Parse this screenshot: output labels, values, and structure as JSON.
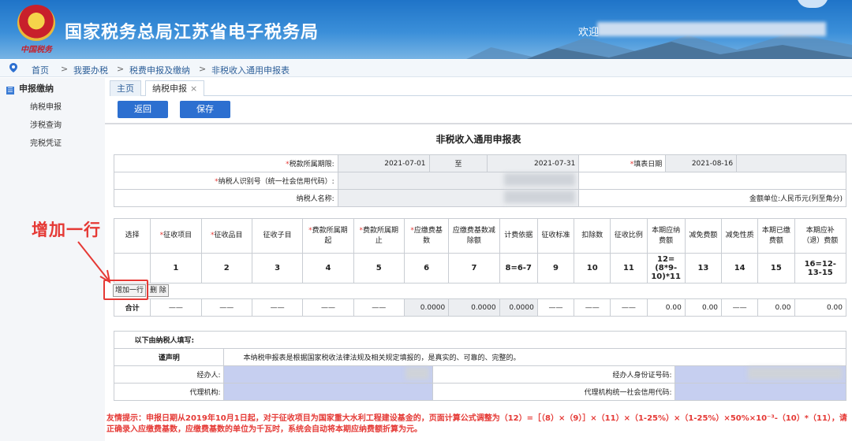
{
  "header": {
    "site_title": "国家税务总局江苏省电子税务局",
    "logo_text": "中国税务",
    "welcome": "欢迎"
  },
  "breadcrumb": [
    "首页",
    "我要办税",
    "税费申报及缴纳",
    "非税收入通用申报表"
  ],
  "sidebar": {
    "heading": "申报缴纳",
    "items": [
      "纳税申报",
      "涉税查询",
      "完税凭证"
    ]
  },
  "tabs": [
    {
      "label": "主页"
    },
    {
      "label": "纳税申报",
      "close": "×"
    }
  ],
  "toolbar": {
    "back_label": "返回",
    "save_label": "保存"
  },
  "form": {
    "title": "非税收入通用申报表",
    "period_label": "税款所属期限:",
    "period_start": "2021-07-01",
    "period_to": "至",
    "period_end": "2021-07-31",
    "fill_date_label": "填表日期",
    "fill_date": "2021-08-16",
    "taxpayer_id_label": "纳税人识别号（统一社会信用代码）:",
    "taxpayer_name_label": "纳税人名称:",
    "amount_unit": "金额单位:人民币元(列至角分)"
  },
  "table": {
    "headers": [
      "选择",
      "征收项目",
      "征收品目",
      "征收子目",
      "费款所属期起",
      "费款所属期止",
      "应缴费基数",
      "应缴费基数减除额",
      "计费依据",
      "征收标准",
      "扣除数",
      "征收比例",
      "本期应纳费额",
      "减免费额",
      "减免性质",
      "本期已缴费额",
      "本期应补（退）费额"
    ],
    "required_cols": [
      1,
      2,
      4,
      5,
      6
    ],
    "numbers": [
      "",
      "1",
      "2",
      "3",
      "4",
      "5",
      "6",
      "7",
      "8=6-7",
      "9",
      "10",
      "11",
      "12=(8*9-10)*11",
      "13",
      "14",
      "15",
      "16=12-13-15"
    ],
    "add_row_label": "增加一行",
    "delete_label": "删 除",
    "total_row": [
      "合计",
      "——",
      "——",
      "——",
      "——",
      "——",
      "0.0000",
      "0.0000",
      "0.0000",
      "——",
      "——",
      "——",
      "0.00",
      "0.00",
      "——",
      "0.00",
      "0.00"
    ]
  },
  "callout": "增加一行",
  "declaration": {
    "section_title": "以下由纳税人填写:",
    "statement_label": "谨声明",
    "statement_text": "本纳税申报表是根据国家税收法律法规及相关规定填报的，是真实的、可靠的、完整的。",
    "agent_label": "经办人:",
    "agent_id_label": "经办人身份证号码:",
    "agency_label": "代理机构:",
    "agency_code_label": "代理机构统一社会信用代码:"
  },
  "note": "友情提示：申报日期从2019年10月1日起，对于征收项目为国家重大水利工程建设基金的，页面计算公式调整为（12）=［（8）×（9）］×（11）×（1-25%）×（1-25%）×50%×10⁻³-（10）*（11），请正确录入应缴费基数，应缴费基数的单位为千瓦时，系统会自动将本期应纳费额折算为元。",
  "colors": {
    "brand_blue": "#2c6fd0",
    "alert_red": "#e53935",
    "input_blue": "#c6cff0"
  }
}
